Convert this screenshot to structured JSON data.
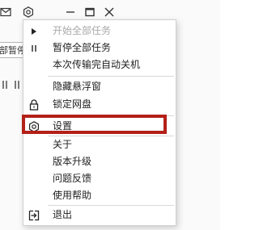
{
  "background": {
    "pause_all_button_label": "部暂停",
    "titlebar_icons": [
      "mail-icon",
      "gear-icon",
      "minimize-icon",
      "maximize-icon",
      "close-icon"
    ]
  },
  "menu": {
    "items": [
      {
        "label": "开始全部任务",
        "icon": "play-icon",
        "disabled": true
      },
      {
        "label": "暂停全部任务",
        "icon": "pause-icon",
        "disabled": false
      },
      {
        "label": "本次传输完自动关机",
        "icon": "",
        "disabled": false
      },
      {
        "label": "隐藏悬浮窗",
        "icon": "",
        "disabled": false
      },
      {
        "label": "锁定网盘",
        "icon": "lock-icon",
        "disabled": false
      },
      {
        "label": "设置",
        "icon": "gear-icon",
        "disabled": false
      },
      {
        "label": "关于",
        "icon": "",
        "disabled": false
      },
      {
        "label": "版本升级",
        "icon": "",
        "disabled": false
      },
      {
        "label": "问题反馈",
        "icon": "",
        "disabled": false
      },
      {
        "label": "使用帮助",
        "icon": "",
        "disabled": false
      },
      {
        "label": "退出",
        "icon": "exit-icon",
        "disabled": false
      }
    ],
    "highlighted_item": "设置",
    "highlight_color": "#b32018"
  }
}
